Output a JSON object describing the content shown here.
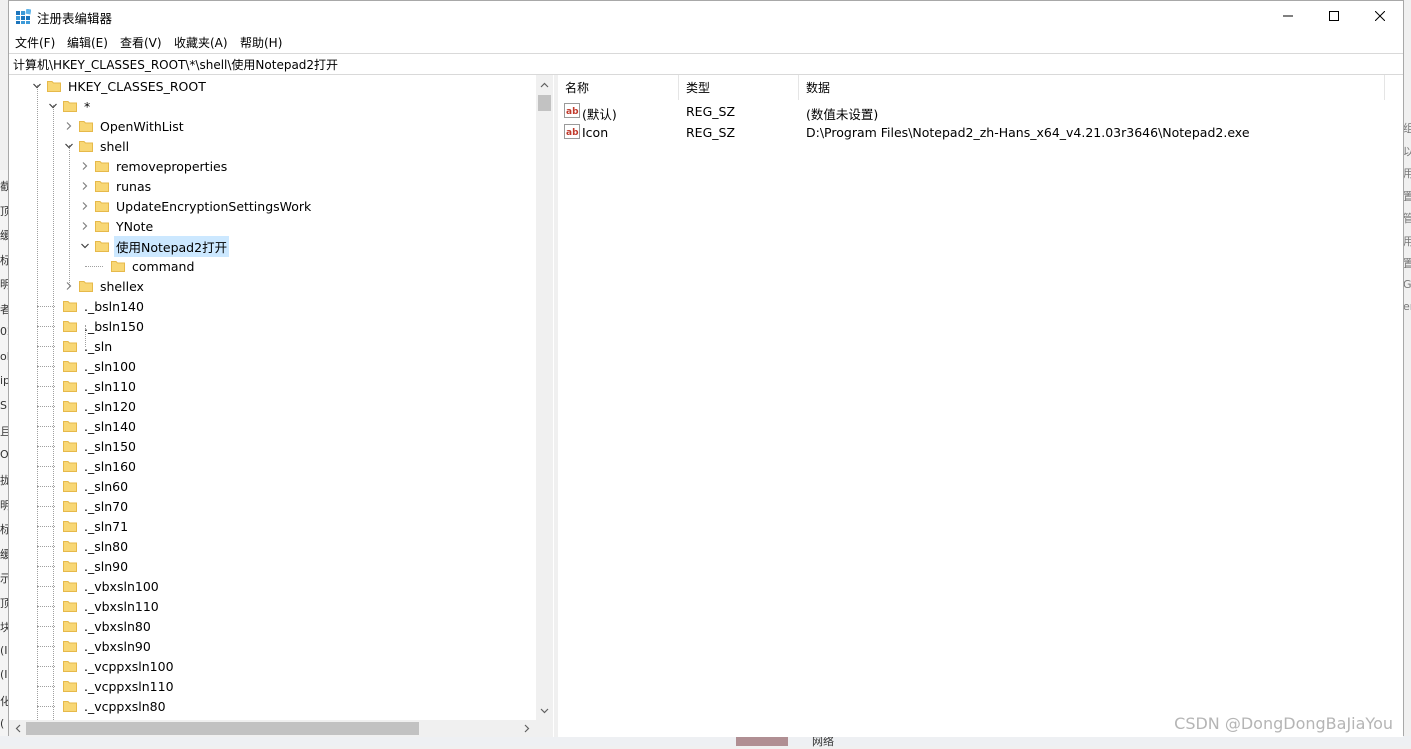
{
  "window": {
    "title": "注册表编辑器"
  },
  "menu": [
    "文件(F)",
    "编辑(E)",
    "查看(V)",
    "收藏夹(A)",
    "帮助(H)"
  ],
  "address": "计算机\\HKEY_CLASSES_ROOT\\*\\shell\\使用Notepad2打开",
  "tree": [
    {
      "label": "HKEY_CLASSES_ROOT",
      "expander": "open"
    },
    {
      "label": "*",
      "expander": "open"
    },
    {
      "label": "OpenWithList",
      "expander": "closed"
    },
    {
      "label": "shell",
      "expander": "open"
    },
    {
      "label": "removeproperties",
      "expander": "closed"
    },
    {
      "label": "runas",
      "expander": "closed"
    },
    {
      "label": "UpdateEncryptionSettingsWork",
      "expander": "closed"
    },
    {
      "label": "YNote",
      "expander": "closed"
    },
    {
      "label": "使用Notepad2打开",
      "expander": "open",
      "selected": true
    },
    {
      "label": "command",
      "expander": "none"
    },
    {
      "label": "shellex",
      "expander": "closed"
    },
    {
      "label": "._bsln140",
      "expander": "none"
    },
    {
      "label": "._bsln150",
      "expander": "none"
    },
    {
      "label": "._sln",
      "expander": "none"
    },
    {
      "label": "._sln100",
      "expander": "none"
    },
    {
      "label": "._sln110",
      "expander": "none"
    },
    {
      "label": "._sln120",
      "expander": "none"
    },
    {
      "label": "._sln140",
      "expander": "none"
    },
    {
      "label": "._sln150",
      "expander": "none"
    },
    {
      "label": "._sln160",
      "expander": "none"
    },
    {
      "label": "._sln60",
      "expander": "none"
    },
    {
      "label": "._sln70",
      "expander": "none"
    },
    {
      "label": "._sln71",
      "expander": "none"
    },
    {
      "label": "._sln80",
      "expander": "none"
    },
    {
      "label": "._sln90",
      "expander": "none"
    },
    {
      "label": "._vbxsln100",
      "expander": "none"
    },
    {
      "label": "._vbxsln110",
      "expander": "none"
    },
    {
      "label": "._vbxsln80",
      "expander": "none"
    },
    {
      "label": "._vbxsln90",
      "expander": "none"
    },
    {
      "label": "._vcppxsln100",
      "expander": "none"
    },
    {
      "label": "._vcppxsln110",
      "expander": "none"
    },
    {
      "label": "._vcppxsln80",
      "expander": "none"
    }
  ],
  "list": {
    "columns": [
      "名称",
      "类型",
      "数据"
    ],
    "rows": [
      {
        "name": "(默认)",
        "type": "REG_SZ",
        "data": "(数值未设置)"
      },
      {
        "name": "Icon",
        "type": "REG_SZ",
        "data": "D:\\Program Files\\Notepad2_zh-Hans_x64_v4.21.03r3646\\Notepad2.exe"
      }
    ]
  },
  "watermark": "CSDN @DongDongBaJiaYou",
  "background": {
    "left_fragments": [
      "截",
      "顶",
      "缓",
      "标",
      "明",
      "者",
      "02",
      "ol",
      "ip",
      "S",
      "且",
      "O",
      "拢",
      "明",
      "标",
      "缓",
      "示",
      "顶",
      "块",
      "(I",
      "(I",
      "化",
      "("
    ],
    "right_fragments": [
      "组",
      "以",
      "用",
      "置",
      "管",
      "用",
      "置",
      "G",
      "er"
    ],
    "taskbar_label": "网络"
  },
  "colors": {
    "selection": "#cce8ff",
    "folder": "#f8d775",
    "folder_dark": "#e6b94a",
    "accent": "#0078d7"
  }
}
